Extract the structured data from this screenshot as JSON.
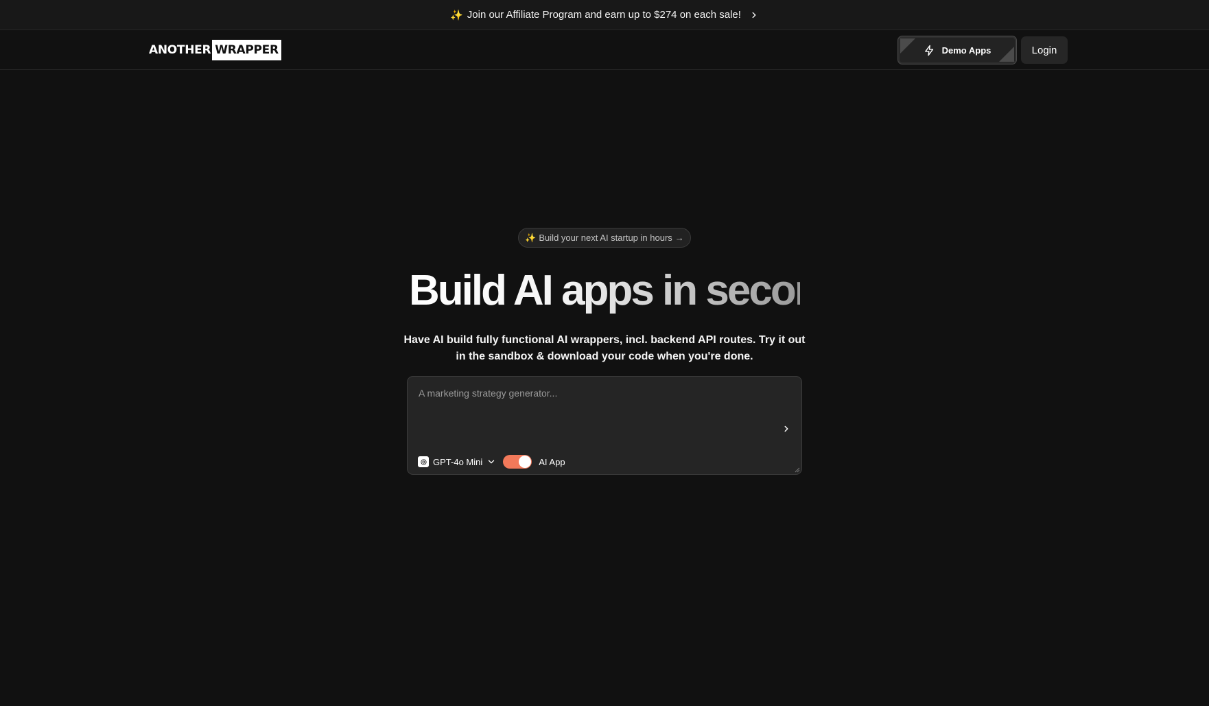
{
  "banner": {
    "sparkle": "✨",
    "text": "Join our Affiliate Program and earn up to $274 on each sale!"
  },
  "nav": {
    "logo_part1": "ANOTHER",
    "logo_part2": "WRAPPER",
    "demo_apps_label": "Demo Apps",
    "login_label": "Login"
  },
  "hero": {
    "pill_sparkle": "✨",
    "pill_text": "Build your next AI startup in hours",
    "pill_arrow": "→",
    "headline": "Build AI apps in seconds",
    "subtitle": "Have AI build fully functional AI wrappers, incl. backend API routes. Try it out in the sandbox & download your code when you're done."
  },
  "prompt": {
    "placeholder": "A marketing strategy generator...",
    "value": "",
    "model": "GPT-4o Mini",
    "toggle_label": "AI App",
    "toggle_on": true,
    "toggle_color": "#f2795a"
  },
  "icons": {
    "banner_chevron": "chevron-right-icon",
    "demo_apps": "lightning-bolt-icon",
    "send": "chevron-right-icon",
    "model": "openai-logo-icon",
    "model_dropdown": "chevron-down-icon"
  }
}
